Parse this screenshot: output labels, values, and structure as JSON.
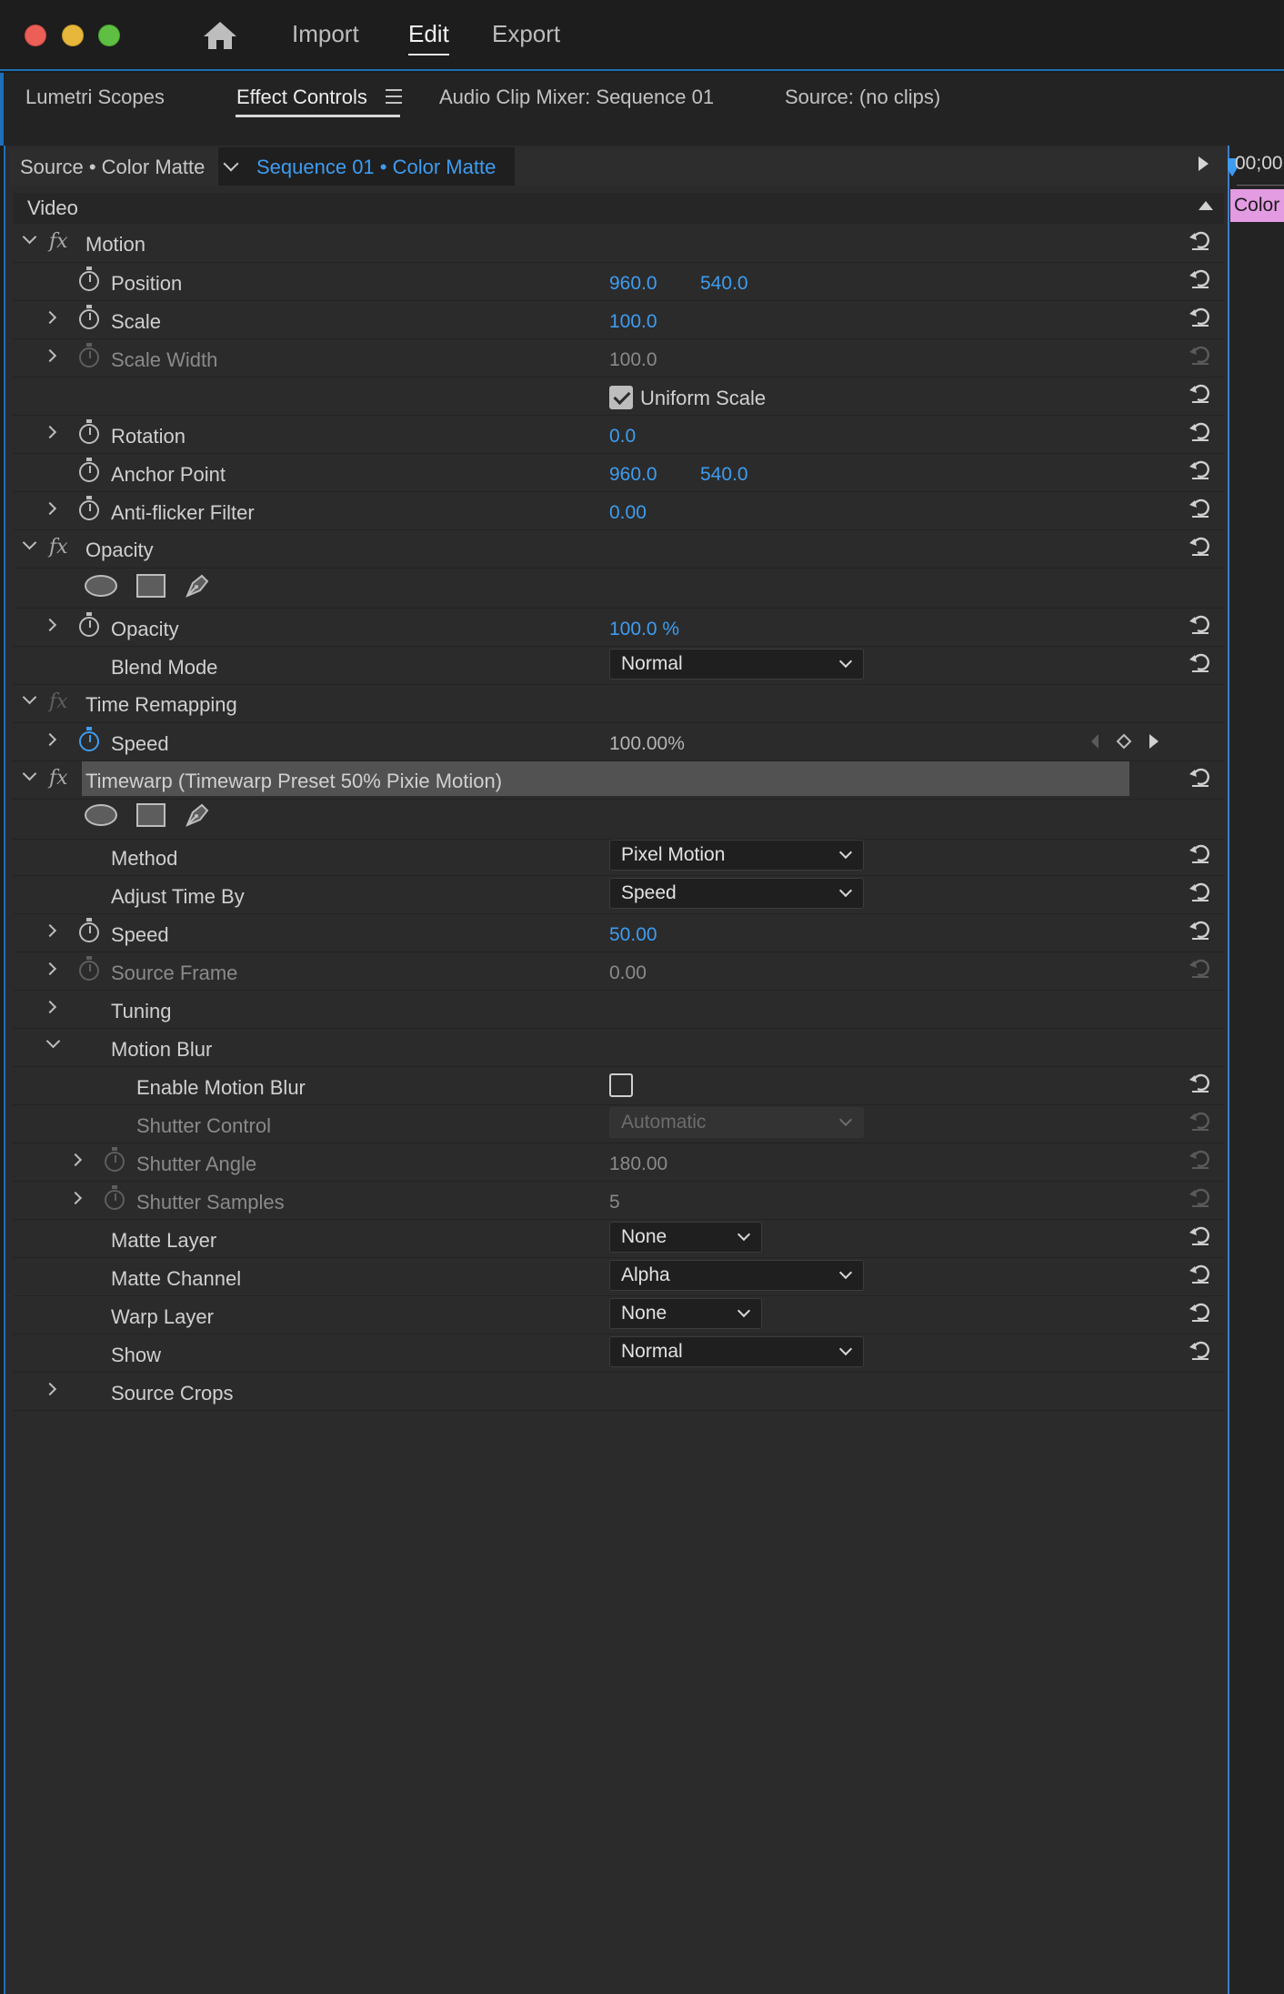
{
  "window": {
    "nav": {
      "import": "Import",
      "edit": "Edit",
      "export": "Export"
    }
  },
  "tabs": {
    "lumetri": "Lumetri Scopes",
    "effect_controls": "Effect Controls",
    "audio_mixer": "Audio Clip Mixer: Sequence 01",
    "source": "Source: (no clips)"
  },
  "source_bar": {
    "source": "Source • Color Matte",
    "sequence": "Sequence 01 • Color Matte"
  },
  "timeline": {
    "timecode": "00;00",
    "clip": "Color"
  },
  "section": {
    "video": "Video"
  },
  "motion": {
    "title": "Motion",
    "position": {
      "label": "Position",
      "x": "960.0",
      "y": "540.0"
    },
    "scale": {
      "label": "Scale",
      "value": "100.0"
    },
    "scale_width": {
      "label": "Scale Width",
      "value": "100.0"
    },
    "uniform_scale": {
      "label": "Uniform Scale",
      "checked": true
    },
    "rotation": {
      "label": "Rotation",
      "value": "0.0"
    },
    "anchor_point": {
      "label": "Anchor Point",
      "x": "960.0",
      "y": "540.0"
    },
    "anti_flicker": {
      "label": "Anti-flicker Filter",
      "value": "0.00"
    }
  },
  "opacity": {
    "title": "Opacity",
    "opacity": {
      "label": "Opacity",
      "value": "100.0 %"
    },
    "blend_mode": {
      "label": "Blend Mode",
      "value": "Normal"
    }
  },
  "time_remapping": {
    "title": "Time Remapping",
    "speed": {
      "label": "Speed",
      "value": "100.00%"
    }
  },
  "timewarp": {
    "title": "Timewarp (Timewarp Preset 50% Pixie Motion)",
    "method": {
      "label": "Method",
      "value": "Pixel Motion"
    },
    "adjust_time_by": {
      "label": "Adjust Time By",
      "value": "Speed"
    },
    "speed": {
      "label": "Speed",
      "value": "50.00"
    },
    "source_frame": {
      "label": "Source Frame",
      "value": "0.00"
    },
    "tuning": {
      "label": "Tuning"
    },
    "motion_blur": {
      "label": "Motion Blur"
    },
    "enable_motion_blur": {
      "label": "Enable Motion Blur",
      "checked": false
    },
    "shutter_control": {
      "label": "Shutter Control",
      "value": "Automatic"
    },
    "shutter_angle": {
      "label": "Shutter Angle",
      "value": "180.00"
    },
    "shutter_samples": {
      "label": "Shutter Samples",
      "value": "5"
    },
    "matte_layer": {
      "label": "Matte Layer",
      "value": "None"
    },
    "matte_channel": {
      "label": "Matte Channel",
      "value": "Alpha"
    },
    "warp_layer": {
      "label": "Warp Layer",
      "value": "None"
    },
    "show": {
      "label": "Show",
      "value": "Normal"
    },
    "source_crops": {
      "label": "Source Crops"
    }
  },
  "colors": {
    "accent": "#3e9cf0",
    "panel": "#2b2b2b",
    "clip": "#e39be2"
  }
}
